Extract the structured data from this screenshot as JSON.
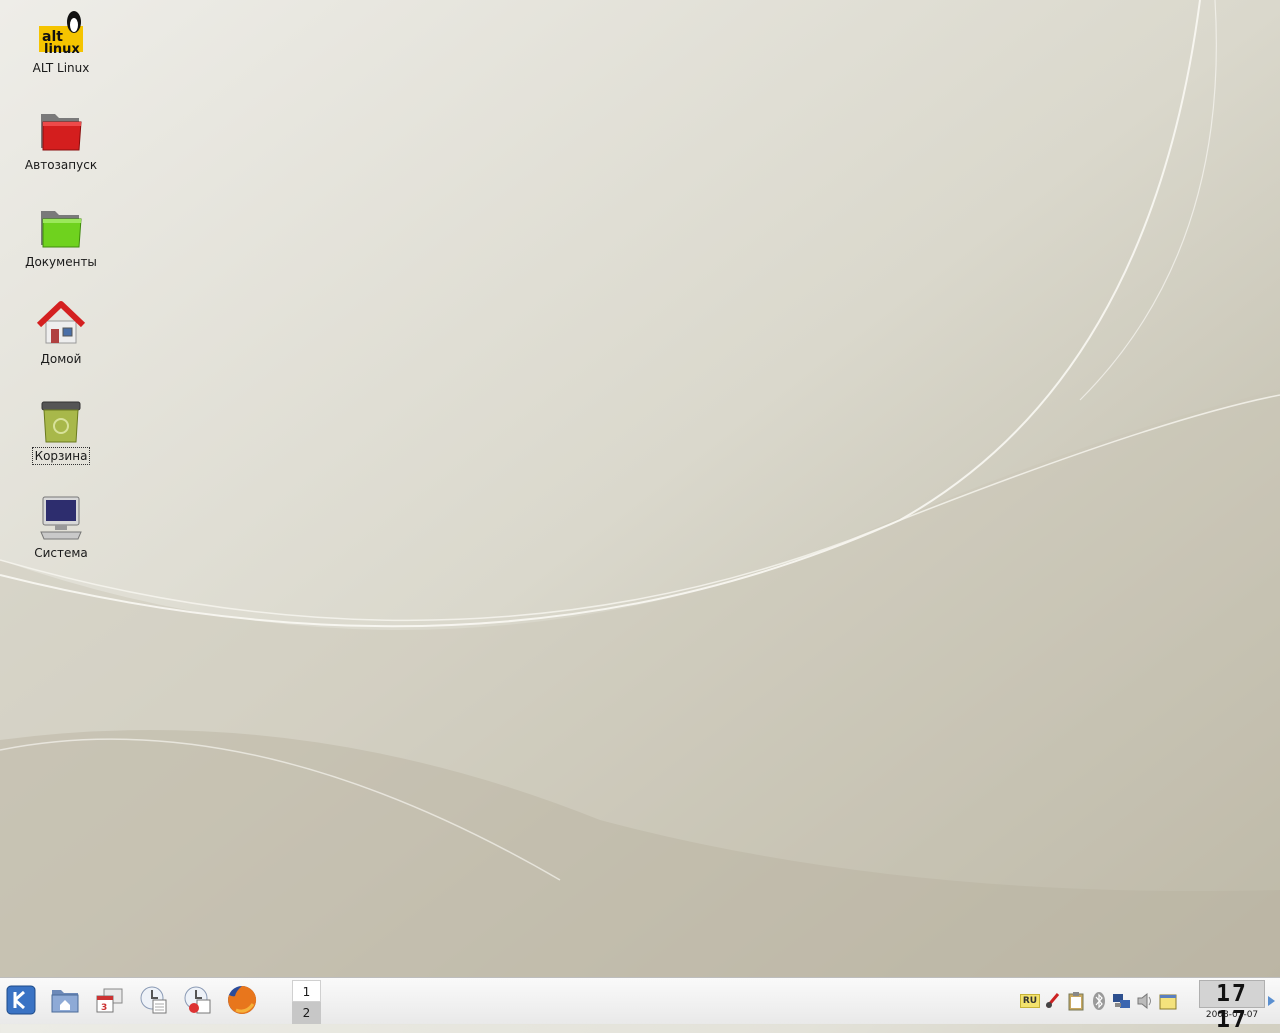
{
  "desktop": {
    "icons": [
      {
        "label": "ALT Linux",
        "icon": "alt-linux-logo-icon"
      },
      {
        "label": "Автозапуск",
        "icon": "red-folder-icon"
      },
      {
        "label": "Документы",
        "icon": "green-folder-icon"
      },
      {
        "label": "Домой",
        "icon": "home-icon"
      },
      {
        "label": "Корзина",
        "icon": "trash-icon",
        "selected": true
      },
      {
        "label": "Система",
        "icon": "computer-icon"
      }
    ],
    "logo_text": [
      "alt",
      "linux"
    ]
  },
  "taskbar": {
    "launchers": [
      {
        "icon": "kde-menu-icon"
      },
      {
        "icon": "home-folder-icon"
      },
      {
        "icon": "calendar-mail-icon"
      },
      {
        "icon": "mail-client-icon"
      },
      {
        "icon": "mail-config-icon"
      },
      {
        "icon": "firefox-icon"
      }
    ],
    "pager": {
      "desktops": [
        "1",
        "2"
      ],
      "active": "1"
    },
    "tray": {
      "keyboard_layout": "RU",
      "icons": [
        "klipper-icon",
        "clipboard-icon",
        "bluetooth-icon",
        "network-icon",
        "volume-icon",
        "notes-icon"
      ]
    },
    "clock": {
      "time": "17 17",
      "date": "2008-01-07"
    }
  },
  "colors": {
    "accent": "#5a8fd0",
    "desktop_bg": "#d9d7cb",
    "taskbar_bg": "#f0f0f0"
  }
}
